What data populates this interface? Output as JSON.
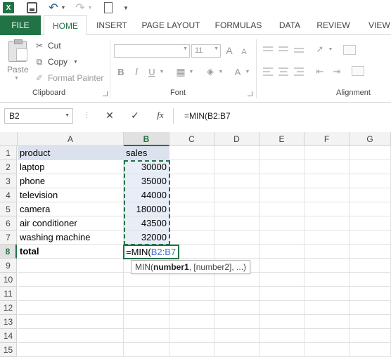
{
  "app": {
    "logo_text": "X",
    "accent": "#217346"
  },
  "ribbon_tabs": [
    "FILE",
    "HOME",
    "INSERT",
    "PAGE LAYOUT",
    "FORMULAS",
    "DATA",
    "REVIEW",
    "VIEW"
  ],
  "clipboard": {
    "paste_label": "Paste",
    "cut_label": "Cut",
    "copy_label": "Copy",
    "format_painter_label": "Format Painter",
    "group_label": "Clipboard"
  },
  "font": {
    "size_value": "11",
    "bold_label": "B",
    "italic_label": "I",
    "underline_label": "U",
    "font_color_label": "A",
    "grow_label": "A",
    "shrink_label": "A",
    "group_label": "Font"
  },
  "alignment": {
    "group_label": "Alignment"
  },
  "formula_bar": {
    "name_box": "B2",
    "cancel_icon": "✕",
    "enter_icon": "✓",
    "insert_function_label": "fx",
    "formula": "=MIN(B2:B7"
  },
  "grid": {
    "columns": [
      "A",
      "B",
      "C",
      "D",
      "E",
      "F",
      "G"
    ],
    "active_column": "B",
    "rows": [
      "1",
      "2",
      "3",
      "4",
      "5",
      "6",
      "7",
      "8",
      "9",
      "10",
      "11",
      "12",
      "13",
      "14",
      "15"
    ],
    "active_row": "8",
    "data": [
      {
        "a": "product",
        "b": "sales"
      },
      {
        "a": "laptop",
        "b": "30000"
      },
      {
        "a": "phone",
        "b": "35000"
      },
      {
        "a": "television",
        "b": "44000"
      },
      {
        "a": "camera",
        "b": "180000"
      },
      {
        "a": "air conditioner",
        "b": "43500"
      },
      {
        "a": "washing machine",
        "b": "32000"
      },
      {
        "a": "total",
        "b": ""
      }
    ],
    "edit_prefix": "=MIN(",
    "edit_ref": "B2:B7"
  },
  "tooltip": {
    "func": "MIN(",
    "arg1": "number1",
    "rest": ", [number2], ...)"
  }
}
